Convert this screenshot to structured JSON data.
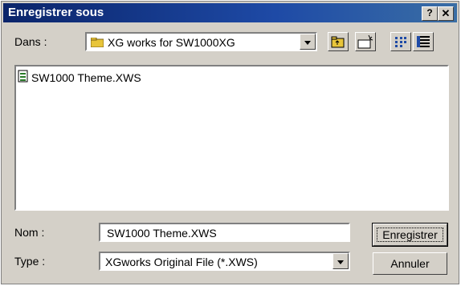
{
  "window": {
    "title": "Enregistrer sous"
  },
  "title_buttons": {
    "help": "?",
    "close": "✕"
  },
  "location": {
    "label": "Dans :",
    "value": "XG works for SW1000XG"
  },
  "file_list": {
    "items": [
      {
        "name": "SW1000 Theme.XWS"
      }
    ]
  },
  "filename": {
    "label": "Nom :",
    "value": "SW1000 Theme.XWS"
  },
  "filetype": {
    "label": "Type :",
    "value": "XGworks Original File (*.XWS)"
  },
  "buttons": {
    "save": "Enregistrer",
    "cancel": "Annuler"
  },
  "colors": {
    "titlebar": "#0a246a",
    "face": "#d4d0c8",
    "folder": "#e8c53a"
  }
}
